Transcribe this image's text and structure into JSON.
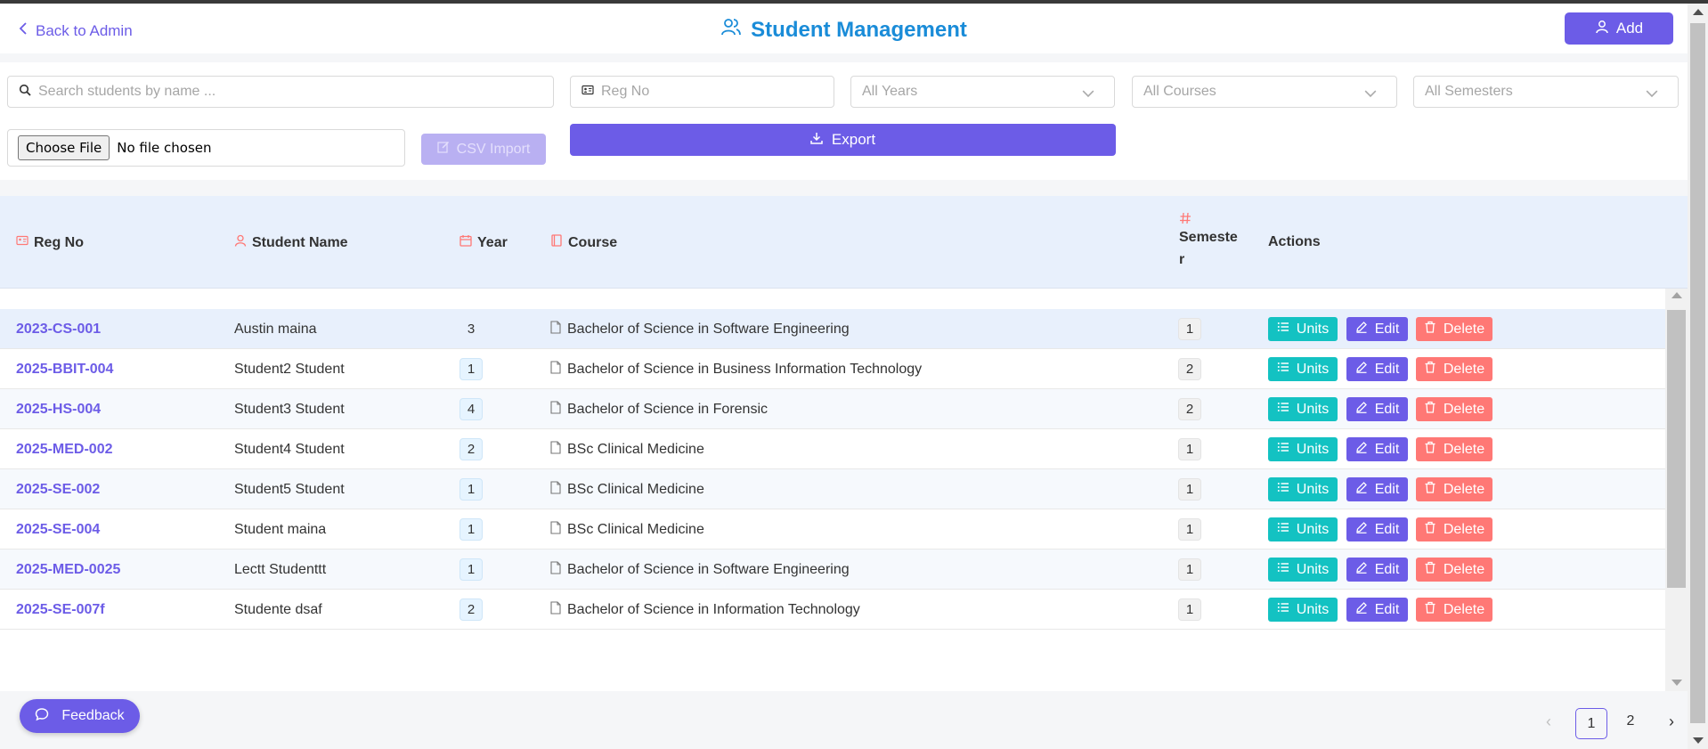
{
  "header": {
    "back_label": "Back to Admin",
    "title": "Student Management",
    "add_label": "Add"
  },
  "filters": {
    "search_placeholder": "Search students by name ...",
    "reg_placeholder": "Reg No",
    "years_value": "All Years",
    "courses_value": "All Courses",
    "semesters_value": "All Semesters",
    "choose_file_label": "Choose File",
    "file_status": "No file chosen",
    "csv_import_label": "CSV Import",
    "export_label": "Export"
  },
  "table": {
    "columns": {
      "reg_no": "Reg No",
      "student_name": "Student Name",
      "year": "Year",
      "course": "Course",
      "semester": "Semester",
      "actions": "Actions"
    },
    "action_labels": {
      "units": "Units",
      "edit": "Edit",
      "delete": "Delete"
    },
    "rows": [
      {
        "reg_no": "2023-CS-001",
        "name": "Austin maina",
        "year": "3",
        "course": "Bachelor of Science in Software Engineering",
        "semester": "1"
      },
      {
        "reg_no": "2025-BBIT-004",
        "name": "Student2 Student",
        "year": "1",
        "course": "Bachelor of Science in Business Information Technology",
        "semester": "2"
      },
      {
        "reg_no": "2025-HS-004",
        "name": "Student3 Student",
        "year": "4",
        "course": "Bachelor of Science in Forensic",
        "semester": "2"
      },
      {
        "reg_no": "2025-MED-002",
        "name": "Student4 Student",
        "year": "2",
        "course": "BSc Clinical Medicine",
        "semester": "1"
      },
      {
        "reg_no": "2025-SE-002",
        "name": "Student5 Student",
        "year": "1",
        "course": "BSc Clinical Medicine",
        "semester": "1"
      },
      {
        "reg_no": "2025-SE-004",
        "name": "Student maina",
        "year": "1",
        "course": "BSc Clinical Medicine",
        "semester": "1"
      },
      {
        "reg_no": "2025-MED-0025",
        "name": "Lectt Studenttt",
        "year": "1",
        "course": "Bachelor of Science in Software Engineering",
        "semester": "1"
      },
      {
        "reg_no": "2025-SE-007f",
        "name": "Studente dsaf",
        "year": "2",
        "course": "Bachelor of Science in Information Technology",
        "semester": "1"
      }
    ]
  },
  "feedback_label": "Feedback",
  "pagination": {
    "pages": [
      "1",
      "2"
    ],
    "current": "1"
  },
  "colors": {
    "primary": "#6c5ce7",
    "title_blue": "#1a8cd8",
    "units": "#13c2c2",
    "delete": "#ff7875",
    "header_row": "#e8f0fc",
    "icon_red": "#ff7875"
  },
  "icons": {
    "back": "chevron-left-icon",
    "title": "users-icon",
    "add": "user-icon",
    "search": "search-icon",
    "reg": "id-card-icon",
    "dropdown": "chevron-down-icon",
    "csv": "edit-icon",
    "export": "download-icon",
    "year": "calendar-icon",
    "course": "book-icon",
    "semester": "hash-icon",
    "units": "list-icon",
    "edit": "pencil-icon",
    "delete": "trash-icon",
    "feedback": "chat-icon"
  }
}
